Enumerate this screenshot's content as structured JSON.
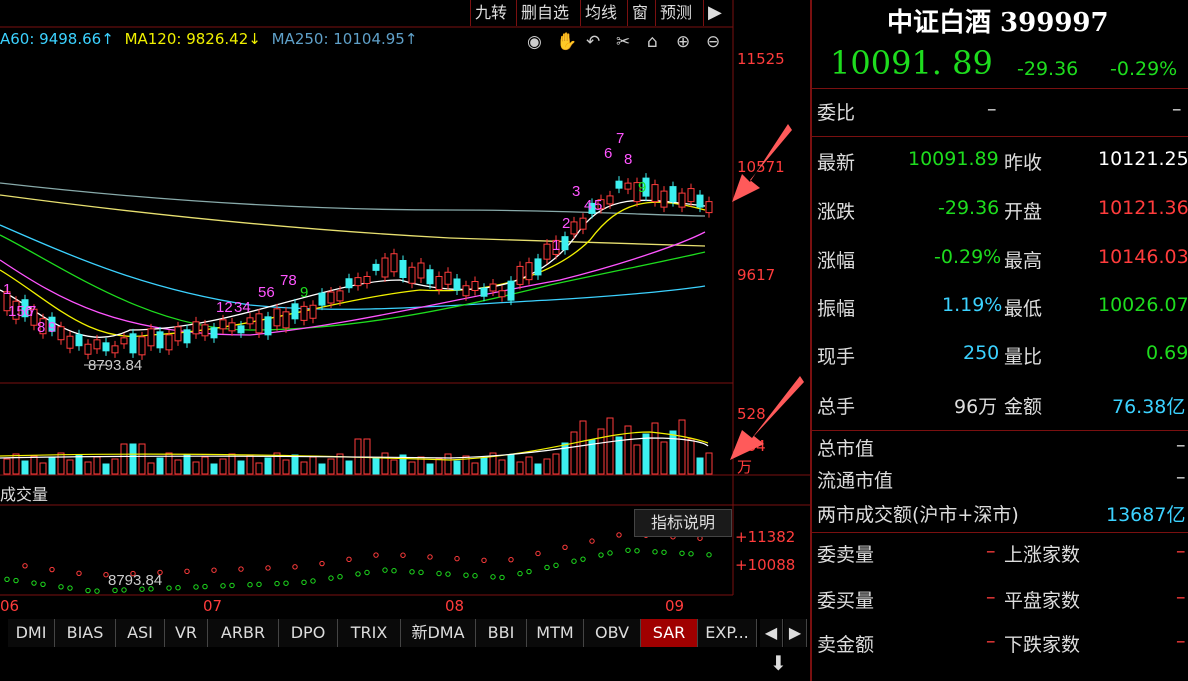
{
  "toolbar": {
    "buttons": [
      "九转",
      "删自选",
      "均线",
      "窗",
      "预测"
    ],
    "more_icon": "right-arrow-icon"
  },
  "ma_legend": {
    "ma60": "A60: 9498.66↑",
    "ma120": "MA120: 9826.42↓",
    "ma250": "MA250: 10104.95↑"
  },
  "tools": [
    "eye-icon",
    "hand-icon",
    "undo-icon",
    "scissors-icon",
    "lock-icon",
    "zoom-in-icon",
    "zoom-out-icon"
  ],
  "price_axis": {
    "top": "11525",
    "mid": "10571",
    "low": "9617"
  },
  "low_marker": "8793.84",
  "volume_axis": {
    "top": "528",
    "mid": "264",
    "unit": "万"
  },
  "volume_label": "成交量",
  "indicator_help": "指标说明",
  "sar_axis": {
    "top": "+11382",
    "low": "+10088"
  },
  "sar_low_marker": "8793.84",
  "x_axis": [
    "06",
    "07",
    "08",
    "09"
  ],
  "tabs": [
    "DMI",
    "BIAS",
    "ASI",
    "VR",
    "ARBR",
    "DPO",
    "TRIX",
    "新DMA",
    "BBI",
    "MTM",
    "OBV",
    "SAR",
    "EXP..."
  ],
  "active_tab": "SAR",
  "quote": {
    "name": "中证白酒 399997",
    "price": "10091. 89",
    "change": "-29.36",
    "change_pct": "-0.29%",
    "weibi_label": "委比",
    "weibi_value": "–",
    "weibi_value2": "–",
    "rows": [
      {
        "l1": "最新",
        "v1": "10091.89",
        "l2": "昨收",
        "v2": "10121.25"
      },
      {
        "l1": "涨跌",
        "v1": "-29.36",
        "l2": "开盘",
        "v2": "10121.36"
      },
      {
        "l1": "涨幅",
        "v1": "-0.29%",
        "l2": "最高",
        "v2": "10146.03"
      },
      {
        "l1": "振幅",
        "v1": "1.19%",
        "l2": "最低",
        "v2": "10026.07"
      },
      {
        "l1": "现手",
        "v1": "250",
        "l2": "量比",
        "v2": "0.69"
      },
      {
        "l1": "总手",
        "v1": "96万",
        "l2": "金额",
        "v2": "76.38亿"
      }
    ],
    "market_cap_label": "总市值",
    "float_cap_label": "流通市值",
    "two_market_label": "两市成交额(沪市+深市)",
    "two_market_value": "13687亿",
    "dash": "–",
    "breadth": [
      {
        "l1": "委卖量",
        "l2": "上涨家数"
      },
      {
        "l1": "委买量",
        "l2": "平盘家数"
      },
      {
        "l1": "卖金额",
        "l2": "下跌家数"
      }
    ]
  },
  "colors": {
    "up": "#ff3c3c",
    "down": "#1edc1e",
    "border": "#7a1010"
  }
}
